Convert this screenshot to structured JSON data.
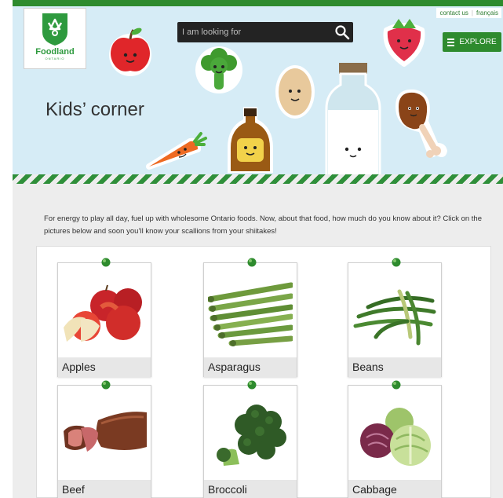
{
  "header": {
    "logo_name": "Foodland",
    "logo_sub": "ONTARIO",
    "links": [
      "contact us",
      "français"
    ],
    "search_placeholder": "I am looking for",
    "explore_label": "EXPLORE",
    "title": "Kids’ corner"
  },
  "intro": "For energy to play all day, fuel up with wholesome Ontario foods. Now, about that food, how much do you know about it? Click on the pictures below and soon you’ll know your scallions from your shiitakes!",
  "foods": [
    {
      "label": "Apples"
    },
    {
      "label": "Asparagus"
    },
    {
      "label": "Beans"
    },
    {
      "label": "Beef"
    },
    {
      "label": "Broccoli"
    },
    {
      "label": "Cabbage"
    }
  ],
  "colors": {
    "brand_green": "#2e8b2e",
    "banner_blue": "#d6ecf6",
    "page_bg": "#ededed"
  }
}
